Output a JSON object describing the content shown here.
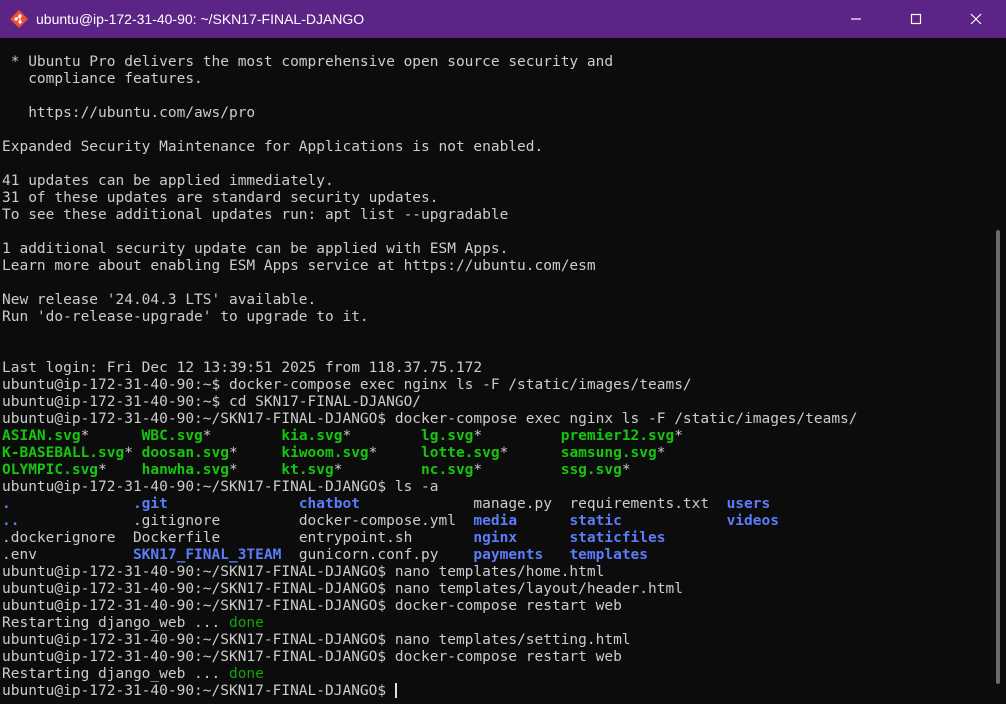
{
  "window": {
    "title": "ubuntu@ip-172-31-40-90: ~/SKN17-FINAL-DJANGO",
    "app_icon": "git-bash-diamond-icon",
    "controls": {
      "minimize": "minimize-icon",
      "maximize": "maximize-icon",
      "close": "close-icon"
    }
  },
  "colors": {
    "titlebar": "#5d2487",
    "background": "#0c0c0c",
    "text": "#cccccc",
    "exec": "#16c60c",
    "dir": "#5c7cfa",
    "done": "#13a10e"
  },
  "lines": [
    {
      "segs": [
        {
          "t": " * Ubuntu Pro delivers the most comprehensive open source security and"
        }
      ]
    },
    {
      "segs": [
        {
          "t": "   compliance features."
        }
      ]
    },
    {
      "segs": [
        {
          "t": ""
        }
      ]
    },
    {
      "segs": [
        {
          "t": "   https://ubuntu.com/aws/pro"
        }
      ]
    },
    {
      "segs": [
        {
          "t": ""
        }
      ]
    },
    {
      "segs": [
        {
          "t": "Expanded Security Maintenance for Applications is not enabled."
        }
      ]
    },
    {
      "segs": [
        {
          "t": ""
        }
      ]
    },
    {
      "segs": [
        {
          "t": "41 updates can be applied immediately."
        }
      ]
    },
    {
      "segs": [
        {
          "t": "31 of these updates are standard security updates."
        }
      ]
    },
    {
      "segs": [
        {
          "t": "To see these additional updates run: apt list --upgradable"
        }
      ]
    },
    {
      "segs": [
        {
          "t": ""
        }
      ]
    },
    {
      "segs": [
        {
          "t": "1 additional security update can be applied with ESM Apps."
        }
      ]
    },
    {
      "segs": [
        {
          "t": "Learn more about enabling ESM Apps service at https://ubuntu.com/esm"
        }
      ]
    },
    {
      "segs": [
        {
          "t": ""
        }
      ]
    },
    {
      "segs": [
        {
          "t": "New release '24.04.3 LTS' available."
        }
      ]
    },
    {
      "segs": [
        {
          "t": "Run 'do-release-upgrade' to upgrade to it."
        }
      ]
    },
    {
      "segs": [
        {
          "t": ""
        }
      ]
    },
    {
      "segs": [
        {
          "t": ""
        }
      ]
    },
    {
      "segs": [
        {
          "t": "Last login: Fri Dec 12 13:39:51 2025 from 118.37.75.172"
        }
      ]
    },
    {
      "segs": [
        {
          "t": "ubuntu@ip-172-31-40-90:~$ docker-compose exec nginx ls -F /static/images/teams/"
        }
      ]
    },
    {
      "segs": [
        {
          "t": "ubuntu@ip-172-31-40-90:~$ cd SKN17-FINAL-DJANGO/"
        }
      ]
    },
    {
      "segs": [
        {
          "t": "ubuntu@ip-172-31-40-90:~/SKN17-FINAL-DJANGO$ docker-compose exec nginx ls -F /static/images/teams/"
        }
      ]
    },
    {
      "segs": [
        {
          "c": 0,
          "t": "ASIAN.svg",
          "k": "exec"
        },
        {
          "c": 9,
          "t": "*"
        },
        {
          "c": 16,
          "t": "WBC.svg",
          "k": "exec"
        },
        {
          "c": 23,
          "t": "*"
        },
        {
          "c": 32,
          "t": "kia.svg",
          "k": "exec"
        },
        {
          "c": 39,
          "t": "*"
        },
        {
          "c": 48,
          "t": "lg.svg",
          "k": "exec"
        },
        {
          "c": 54,
          "t": "*"
        },
        {
          "c": 64,
          "t": "premier12.svg",
          "k": "exec"
        },
        {
          "c": 77,
          "t": "*"
        }
      ]
    },
    {
      "segs": [
        {
          "c": 0,
          "t": "K-BASEBALL.svg",
          "k": "exec"
        },
        {
          "c": 14,
          "t": "*"
        },
        {
          "c": 16,
          "t": "doosan.svg",
          "k": "exec"
        },
        {
          "c": 26,
          "t": "*"
        },
        {
          "c": 32,
          "t": "kiwoom.svg",
          "k": "exec"
        },
        {
          "c": 42,
          "t": "*"
        },
        {
          "c": 48,
          "t": "lotte.svg",
          "k": "exec"
        },
        {
          "c": 57,
          "t": "*"
        },
        {
          "c": 64,
          "t": "samsung.svg",
          "k": "exec"
        },
        {
          "c": 75,
          "t": "*"
        }
      ]
    },
    {
      "segs": [
        {
          "c": 0,
          "t": "OLYMPIC.svg",
          "k": "exec"
        },
        {
          "c": 11,
          "t": "*"
        },
        {
          "c": 16,
          "t": "hanwha.svg",
          "k": "exec"
        },
        {
          "c": 26,
          "t": "*"
        },
        {
          "c": 32,
          "t": "kt.svg",
          "k": "exec"
        },
        {
          "c": 38,
          "t": "*"
        },
        {
          "c": 48,
          "t": "nc.svg",
          "k": "exec"
        },
        {
          "c": 54,
          "t": "*"
        },
        {
          "c": 64,
          "t": "ssg.svg",
          "k": "exec"
        },
        {
          "c": 71,
          "t": "*"
        }
      ]
    },
    {
      "segs": [
        {
          "t": "ubuntu@ip-172-31-40-90:~/SKN17-FINAL-DJANGO$ ls -a"
        }
      ]
    },
    {
      "segs": [
        {
          "c": 0,
          "t": ".",
          "k": "dir"
        },
        {
          "c": 15,
          "t": ".git",
          "k": "dir"
        },
        {
          "c": 34,
          "t": "chatbot",
          "k": "dir"
        },
        {
          "c": 54,
          "t": "manage.py"
        },
        {
          "c": 65,
          "t": "requirements.txt"
        },
        {
          "c": 83,
          "t": "users",
          "k": "dir"
        }
      ]
    },
    {
      "segs": [
        {
          "c": 0,
          "t": "..",
          "k": "dir"
        },
        {
          "c": 15,
          "t": ".gitignore"
        },
        {
          "c": 34,
          "t": "docker-compose.yml"
        },
        {
          "c": 54,
          "t": "media",
          "k": "dir"
        },
        {
          "c": 65,
          "t": "static",
          "k": "dir"
        },
        {
          "c": 83,
          "t": "videos",
          "k": "dir"
        }
      ]
    },
    {
      "segs": [
        {
          "c": 0,
          "t": ".dockerignore"
        },
        {
          "c": 15,
          "t": "Dockerfile"
        },
        {
          "c": 34,
          "t": "entrypoint.sh"
        },
        {
          "c": 54,
          "t": "nginx",
          "k": "dir"
        },
        {
          "c": 65,
          "t": "staticfiles",
          "k": "dir"
        }
      ]
    },
    {
      "segs": [
        {
          "c": 0,
          "t": ".env"
        },
        {
          "c": 15,
          "t": "SKN17_FINAL_3TEAM",
          "k": "dir"
        },
        {
          "c": 34,
          "t": "gunicorn.conf.py"
        },
        {
          "c": 54,
          "t": "payments",
          "k": "dir"
        },
        {
          "c": 65,
          "t": "templates",
          "k": "dir"
        }
      ]
    },
    {
      "segs": [
        {
          "t": "ubuntu@ip-172-31-40-90:~/SKN17-FINAL-DJANGO$ nano templates/home.html"
        }
      ]
    },
    {
      "segs": [
        {
          "t": "ubuntu@ip-172-31-40-90:~/SKN17-FINAL-DJANGO$ nano templates/layout/header.html"
        }
      ]
    },
    {
      "segs": [
        {
          "t": "ubuntu@ip-172-31-40-90:~/SKN17-FINAL-DJANGO$ docker-compose restart web"
        }
      ]
    },
    {
      "segs": [
        {
          "c": 0,
          "t": "Restarting django_web ... "
        },
        {
          "c": 26,
          "t": "done",
          "k": "done"
        }
      ]
    },
    {
      "segs": [
        {
          "t": "ubuntu@ip-172-31-40-90:~/SKN17-FINAL-DJANGO$ nano templates/setting.html"
        }
      ]
    },
    {
      "segs": [
        {
          "t": "ubuntu@ip-172-31-40-90:~/SKN17-FINAL-DJANGO$ docker-compose restart web"
        }
      ]
    },
    {
      "segs": [
        {
          "c": 0,
          "t": "Restarting django_web ... "
        },
        {
          "c": 26,
          "t": "done",
          "k": "done"
        }
      ]
    },
    {
      "segs": [
        {
          "t": "ubuntu@ip-172-31-40-90:~/SKN17-FINAL-DJANGO$ "
        }
      ],
      "prompt": true
    }
  ]
}
